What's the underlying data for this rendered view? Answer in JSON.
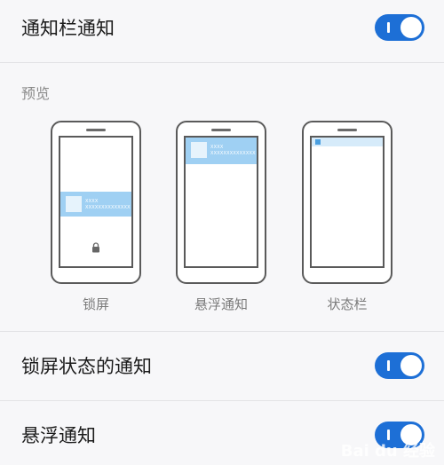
{
  "settings": {
    "status_bar_notification": {
      "label": "通知栏通知",
      "enabled": true
    },
    "lock_screen_notification": {
      "label": "锁屏状态的通知",
      "enabled": true
    },
    "floating_notification": {
      "label": "悬浮通知",
      "enabled": true
    }
  },
  "preview": {
    "label": "预览",
    "items": [
      {
        "caption": "锁屏",
        "line1": "XXXX",
        "line2": "XXXXXXXXXXXXXX"
      },
      {
        "caption": "悬浮通知",
        "line1": "XXXX",
        "line2": "XXXXXXXXXXXXXX"
      },
      {
        "caption": "状态栏"
      }
    ]
  },
  "colors": {
    "accent": "#1d6fd6",
    "notification": "#9fd0f3",
    "background": "#f7f7f9"
  },
  "watermark": "Bai du 经验"
}
